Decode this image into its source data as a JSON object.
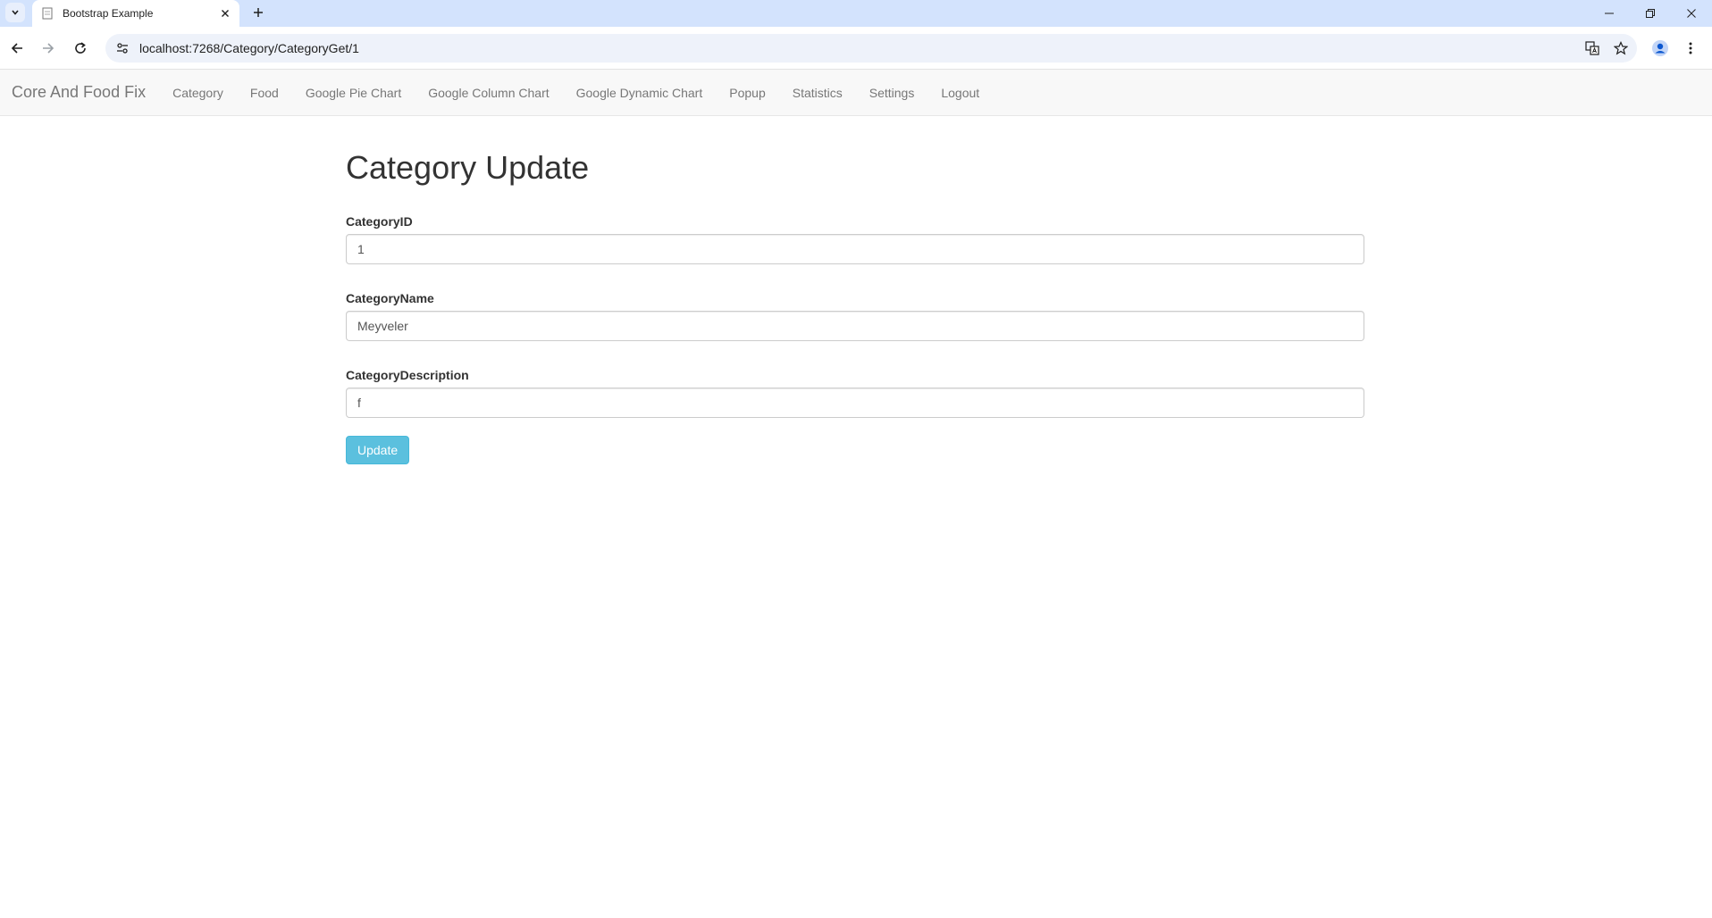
{
  "browser": {
    "tab_title": "Bootstrap Example",
    "url": "localhost:7268/Category/CategoryGet/1"
  },
  "navbar": {
    "brand": "Core And Food Fix",
    "links": [
      "Category",
      "Food",
      "Google Pie Chart",
      "Google Column Chart",
      "Google Dynamic Chart",
      "Popup",
      "Statistics",
      "Settings",
      "Logout"
    ]
  },
  "page": {
    "title": "Category Update"
  },
  "form": {
    "id_label": "CategoryID",
    "id_value": "1",
    "name_label": "CategoryName",
    "name_value": "Meyveler",
    "desc_label": "CategoryDescription",
    "desc_value": "f",
    "submit_label": "Update"
  },
  "colors": {
    "tabstrip": "#d3e3fd",
    "navbar_bg": "#f8f8f8",
    "button_info": "#5bc0de"
  }
}
